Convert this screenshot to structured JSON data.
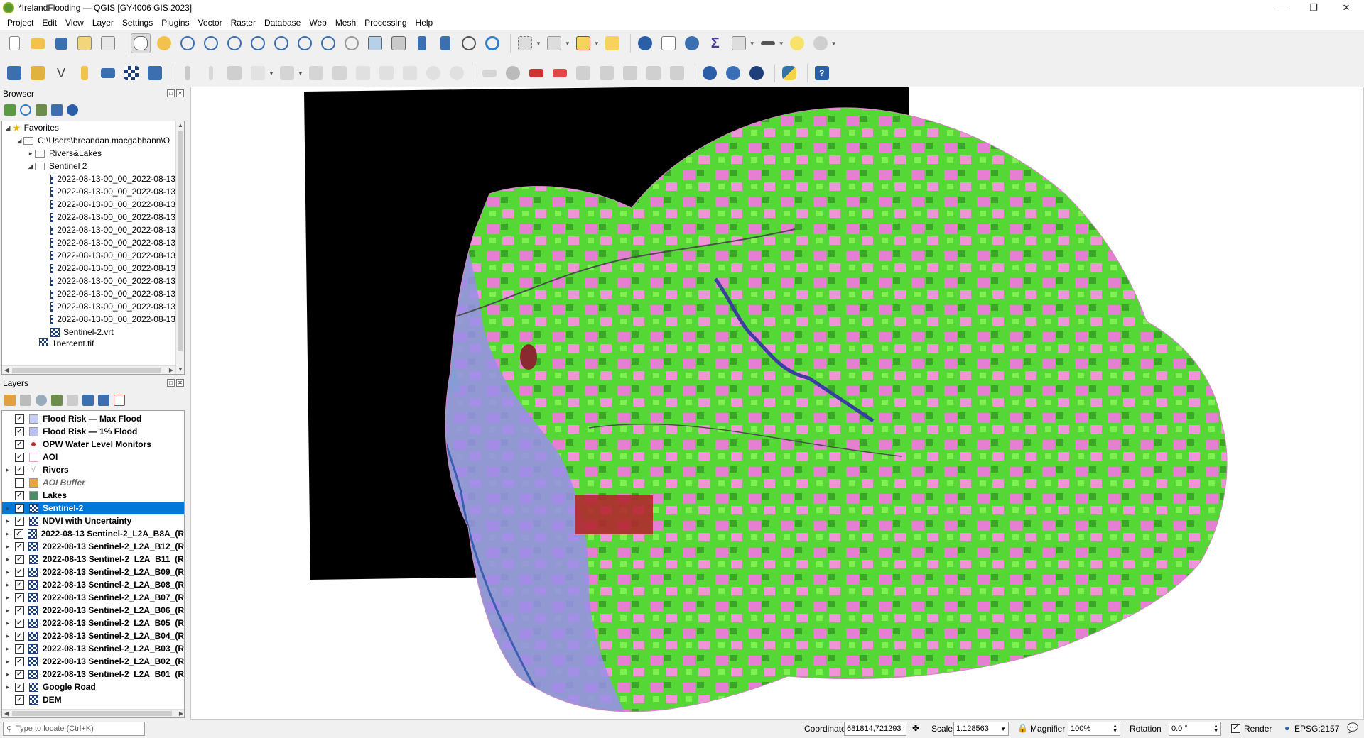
{
  "window": {
    "title": "*IrelandFlooding — QGIS [GY4006 GIS 2023]"
  },
  "menu": [
    "Project",
    "Edit",
    "View",
    "Layer",
    "Settings",
    "Plugins",
    "Vector",
    "Raster",
    "Database",
    "Web",
    "Mesh",
    "Processing",
    "Help"
  ],
  "browser": {
    "title": "Browser",
    "favorites": "Favorites",
    "home_path": "C:\\Users\\breandan.macgabhann\\O",
    "folders": [
      "Rivers&Lakes",
      "Sentinel 2"
    ],
    "sentinel_files": [
      "2022-08-13-00_00_2022-08-13",
      "2022-08-13-00_00_2022-08-13",
      "2022-08-13-00_00_2022-08-13",
      "2022-08-13-00_00_2022-08-13",
      "2022-08-13-00_00_2022-08-13",
      "2022-08-13-00_00_2022-08-13",
      "2022-08-13-00_00_2022-08-13",
      "2022-08-13-00_00_2022-08-13",
      "2022-08-13-00_00_2022-08-13",
      "2022-08-13-00_00_2022-08-13",
      "2022-08-13-00_00_2022-08-13",
      "2022-08-13-00_00_2022-08-13"
    ],
    "vrt": "Sentinel-2.vrt",
    "partial": "1percent.tif"
  },
  "layers": {
    "title": "Layers",
    "items": [
      {
        "name": "Flood Risk — Max Flood",
        "checked": true,
        "sym": "fill",
        "color": "#c6cdf7",
        "expand": false,
        "italic": false
      },
      {
        "name": "Flood Risk — 1% Flood",
        "checked": true,
        "sym": "fill",
        "color": "#b7bff3",
        "expand": false,
        "italic": false
      },
      {
        "name": "OPW Water Level Monitors",
        "checked": true,
        "sym": "point",
        "color": "#b5342e",
        "expand": false,
        "italic": false
      },
      {
        "name": "AOI",
        "checked": true,
        "sym": "outline",
        "color": "#e4a9c8",
        "expand": false,
        "italic": false
      },
      {
        "name": "Rivers",
        "checked": true,
        "sym": "line",
        "color": "#9a9a9a",
        "expand": true,
        "italic": false
      },
      {
        "name": "AOI Buffer",
        "checked": false,
        "sym": "fill",
        "color": "#e8a33d",
        "expand": false,
        "italic": true
      },
      {
        "name": "Lakes",
        "checked": true,
        "sym": "fill",
        "color": "#4e8c67",
        "expand": false,
        "italic": false
      },
      {
        "name": "Sentinel-2",
        "checked": true,
        "sym": "raster",
        "color": "",
        "expand": true,
        "italic": false,
        "selected": true
      },
      {
        "name": "NDVI with Uncertainty",
        "checked": true,
        "sym": "raster",
        "color": "",
        "expand": true,
        "italic": false
      },
      {
        "name": "2022-08-13 Sentinel-2_L2A_B8A_(R",
        "checked": true,
        "sym": "raster",
        "color": "",
        "expand": true,
        "italic": false
      },
      {
        "name": "2022-08-13 Sentinel-2_L2A_B12_(R",
        "checked": true,
        "sym": "raster",
        "color": "",
        "expand": true,
        "italic": false
      },
      {
        "name": "2022-08-13 Sentinel-2_L2A_B11_(R",
        "checked": true,
        "sym": "raster",
        "color": "",
        "expand": true,
        "italic": false
      },
      {
        "name": "2022-08-13 Sentinel-2_L2A_B09_(R",
        "checked": true,
        "sym": "raster",
        "color": "",
        "expand": true,
        "italic": false
      },
      {
        "name": "2022-08-13 Sentinel-2_L2A_B08_(R",
        "checked": true,
        "sym": "raster",
        "color": "",
        "expand": true,
        "italic": false
      },
      {
        "name": "2022-08-13 Sentinel-2_L2A_B07_(R",
        "checked": true,
        "sym": "raster",
        "color": "",
        "expand": true,
        "italic": false
      },
      {
        "name": "2022-08-13 Sentinel-2_L2A_B06_(R",
        "checked": true,
        "sym": "raster",
        "color": "",
        "expand": true,
        "italic": false
      },
      {
        "name": "2022-08-13 Sentinel-2_L2A_B05_(R",
        "checked": true,
        "sym": "raster",
        "color": "",
        "expand": true,
        "italic": false
      },
      {
        "name": "2022-08-13 Sentinel-2_L2A_B04_(R",
        "checked": true,
        "sym": "raster",
        "color": "",
        "expand": true,
        "italic": false
      },
      {
        "name": "2022-08-13 Sentinel-2_L2A_B03_(R",
        "checked": true,
        "sym": "raster",
        "color": "",
        "expand": true,
        "italic": false
      },
      {
        "name": "2022-08-13 Sentinel-2_L2A_B02_(R",
        "checked": true,
        "sym": "raster",
        "color": "",
        "expand": true,
        "italic": false
      },
      {
        "name": "2022-08-13 Sentinel-2_L2A_B01_(R",
        "checked": true,
        "sym": "raster",
        "color": "",
        "expand": true,
        "italic": false
      },
      {
        "name": "Google Road",
        "checked": true,
        "sym": "raster",
        "color": "",
        "expand": true,
        "italic": false
      },
      {
        "name": "DEM",
        "checked": true,
        "sym": "raster",
        "color": "",
        "expand": false,
        "italic": false
      }
    ]
  },
  "status": {
    "locator_placeholder": "Type to locate (Ctrl+K)",
    "coordinate_label": "Coordinate",
    "coordinate_value": "681814,721293",
    "scale_label": "Scale",
    "scale_value": "1:128563",
    "magnifier_label": "Magnifier",
    "magnifier_value": "100%",
    "rotation_label": "Rotation",
    "rotation_value": "0.0 °",
    "render_label": "Render",
    "crs": "EPSG:2157"
  },
  "colors": {
    "selection": "#0078d7",
    "veg_green": "#5be83a",
    "crop_pink": "#e27fd0",
    "flood_violet": "#9a8ee8",
    "river_blue": "#3a3ea0"
  },
  "icons": [
    "new-project-icon",
    "open-project-icon",
    "save-project-icon",
    "pan-icon",
    "zoom-in-icon",
    "zoom-out-icon",
    "refresh-icon",
    "identify-icon",
    "python-icon",
    "help-icon"
  ]
}
